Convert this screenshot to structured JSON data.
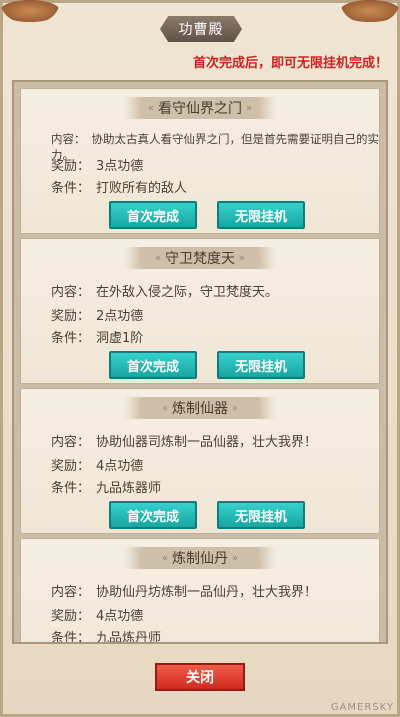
{
  "header": {
    "title": "功曹殿",
    "notice": "首次完成后，即可无限挂机完成！"
  },
  "tasks": [
    {
      "name": "看守仙界之门",
      "content_label": "内容：",
      "content": "协助太古真人看守仙界之门，但是首先需要证明自己的实力。",
      "reward_label": "奖励：",
      "reward": "3点功德",
      "condition_label": "条件：",
      "condition": "打败所有的敌人",
      "first_label": "首次完成",
      "idle_label": "无限挂机"
    },
    {
      "name": "守卫梵度天",
      "content_label": "内容：",
      "content": "在外敌入侵之际，守卫梵度天。",
      "reward_label": "奖励：",
      "reward": "2点功德",
      "condition_label": "条件：",
      "condition": "洞虚1阶",
      "first_label": "首次完成",
      "idle_label": "无限挂机"
    },
    {
      "name": "炼制仙器",
      "content_label": "内容：",
      "content": "协助仙器司炼制一品仙器，壮大我界！",
      "reward_label": "奖励：",
      "reward": "4点功德",
      "condition_label": "条件：",
      "condition": "九品炼器师",
      "first_label": "首次完成",
      "idle_label": "无限挂机"
    },
    {
      "name": "炼制仙丹",
      "content_label": "内容：",
      "content": "协助仙丹坊炼制一品仙丹，壮大我界！",
      "reward_label": "奖励：",
      "reward": "4点功德",
      "condition_label": "条件：",
      "condition": "九品炼丹师"
    }
  ],
  "footer": {
    "close_label": "关闭",
    "watermark": "GAMERSKY"
  }
}
